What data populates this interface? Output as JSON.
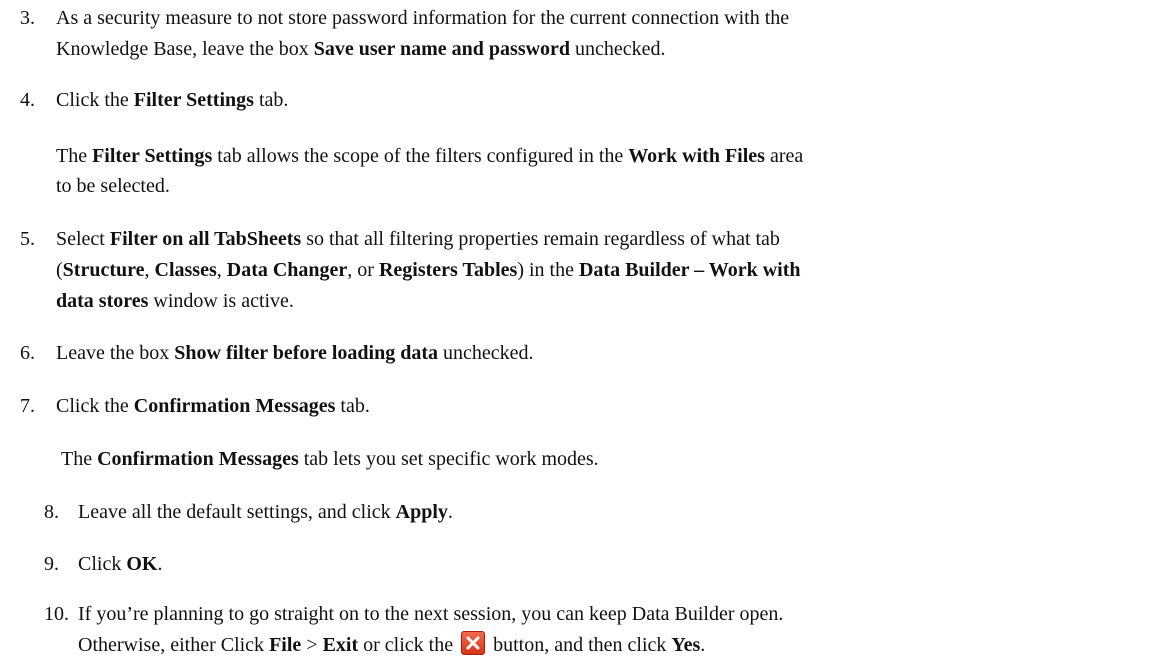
{
  "steps": {
    "s3": {
      "num": "3.",
      "l1": "As a security measure to not store password information for the current connection with the",
      "l2a": "Knowledge Base, leave the box ",
      "l2b": "Save user name and password",
      "l2c": " unchecked."
    },
    "s4": {
      "num": "4.",
      "a": "Click the ",
      "b": "Filter Settings",
      "c": " tab."
    },
    "p4": {
      "a": "The ",
      "b": "Filter Settings",
      "c": " tab allows the scope of the filters configured in the ",
      "d": "Work with Files",
      "e": " area",
      "l2": "to be selected."
    },
    "s5": {
      "num": "5.",
      "a": "Select ",
      "b": "Filter on all TabSheets",
      "c": " so that all filtering properties remain regardless of what tab",
      "d": "(",
      "e": "Structure",
      "f": ", ",
      "g": "Classes",
      "h": ", ",
      "i": "Data Changer",
      "j": ", or ",
      "k": "Registers Tables",
      "l": ") in the ",
      "m": "Data Builder – Work with",
      "n": "data stores",
      "o": " window is active."
    },
    "s6": {
      "num": "6.",
      "a": "Leave the box ",
      "b": "Show filter before loading data",
      "c": " unchecked."
    },
    "s7": {
      "num": "7.",
      "a": "Click the ",
      "b": "Confirmation Messages",
      "c": " tab."
    },
    "p7": {
      "a": "The ",
      "b": "Confirmation Messages",
      "c": " tab lets you set specific work modes."
    },
    "s8": {
      "num": "8.",
      "a": "Leave all the default settings, and click ",
      "b": "Apply",
      "c": "."
    },
    "s9": {
      "num": "9.",
      "a": "Click ",
      "b": "OK",
      "c": "."
    },
    "s10": {
      "num": "10.",
      "l1": "If you’re planning to go straight on to the next session, you can keep Data Builder open.",
      "a": "Otherwise, either Click ",
      "b": "File",
      "c": " > ",
      "d": "Exit",
      "e": " or click the ",
      "f": " button, and then click ",
      "g": "Yes",
      "h": "."
    }
  },
  "icons": {
    "close_button": "close-x-icon",
    "close_color": "#e0462a"
  }
}
